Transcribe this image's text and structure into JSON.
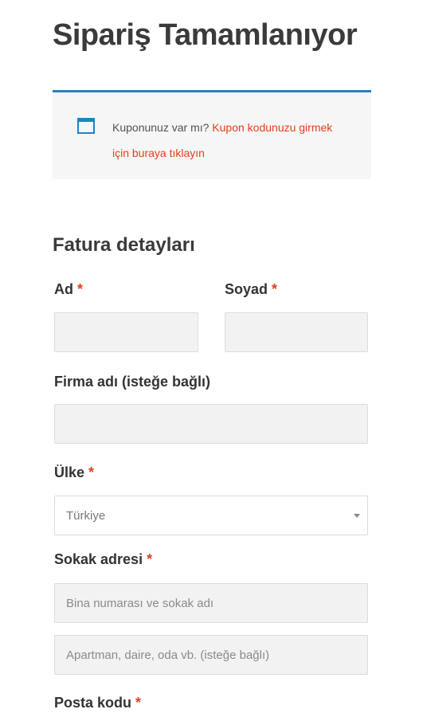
{
  "page": {
    "title": "Sipariş Tamamlanıyor"
  },
  "coupon": {
    "icon": "window-icon",
    "text": "Kuponunuz var mı?",
    "link": "Kupon kodunuzu girmek için buraya tıklayın",
    "accent_color": "#1e85be",
    "link_color": "#e2401c"
  },
  "billing": {
    "title": "Fatura detayları",
    "required_mark": "*",
    "first_name": {
      "label": "Ad",
      "value": ""
    },
    "last_name": {
      "label": "Soyad",
      "value": ""
    },
    "company": {
      "label": "Firma adı (isteğe bağlı)",
      "value": ""
    },
    "country": {
      "label": "Ülke",
      "selected": "Türkiye"
    },
    "street": {
      "label": "Sokak adresi",
      "line1_placeholder": "Bina numarası ve sokak adı",
      "line2_placeholder": "Apartman, daire, oda vb. (isteğe bağlı)"
    },
    "postcode": {
      "label": "Posta kodu"
    }
  }
}
